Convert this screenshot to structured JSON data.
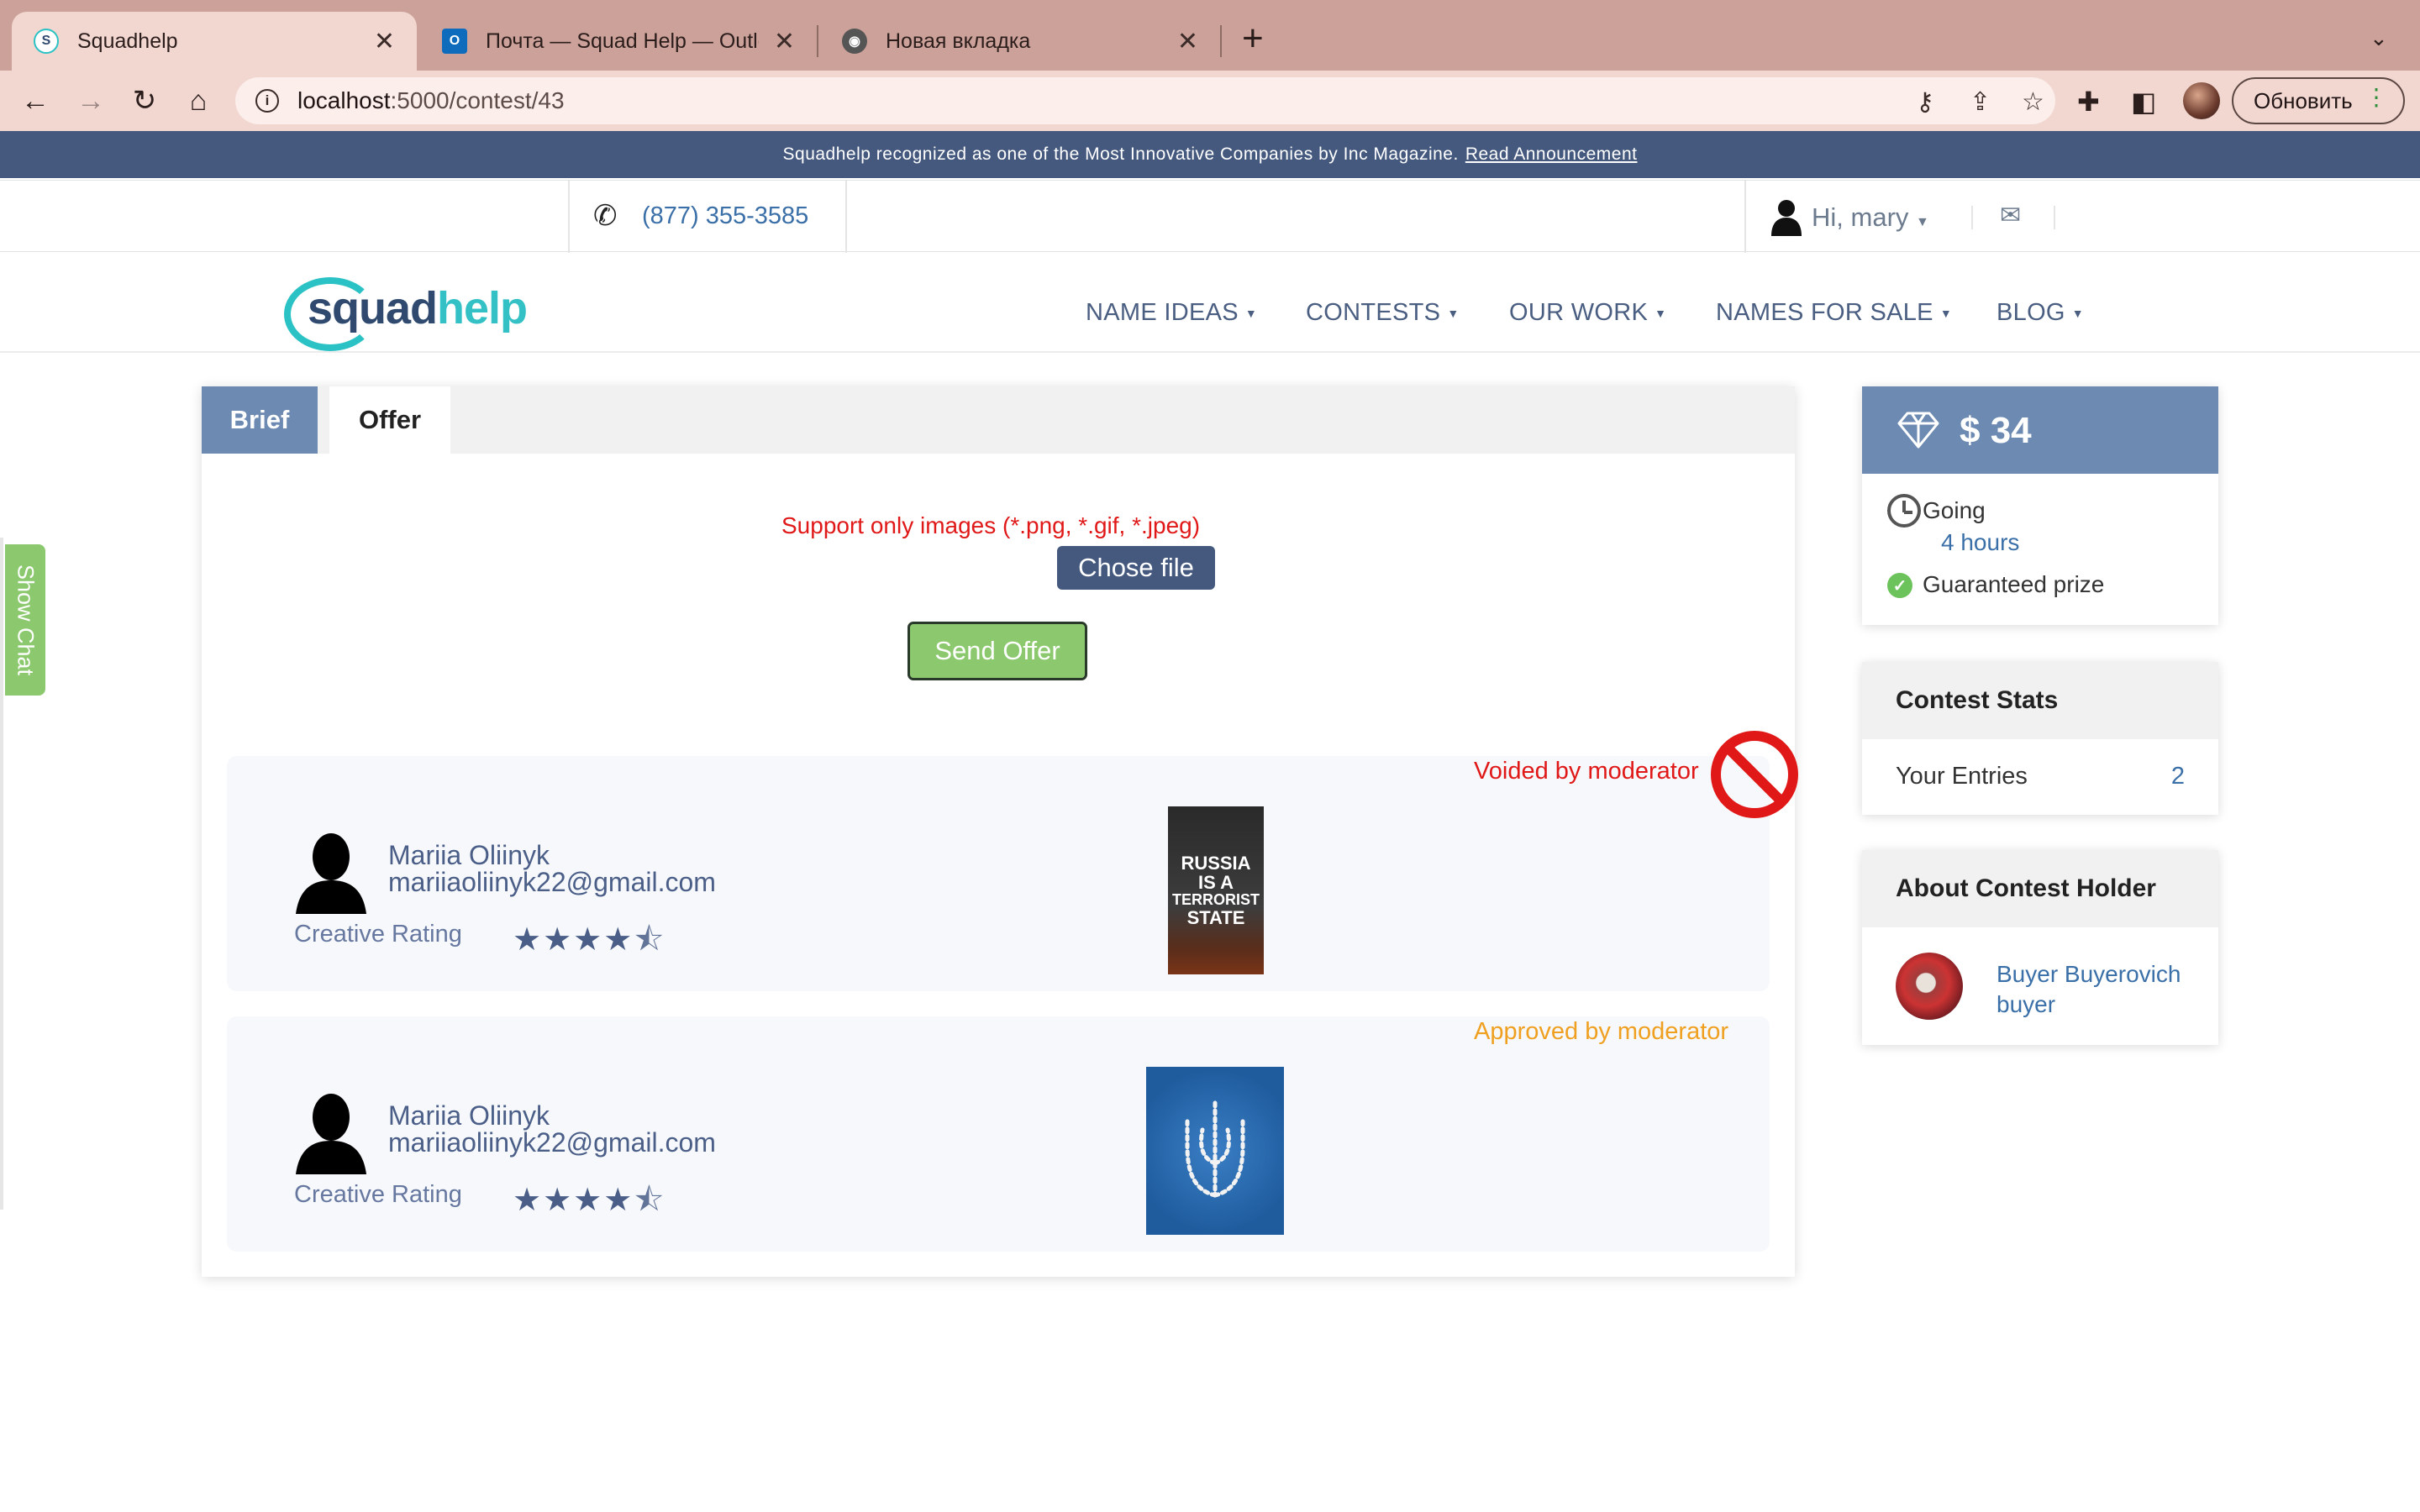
{
  "browser": {
    "tabs": [
      {
        "title": "Squadhelp",
        "active": true,
        "icon": "squadhelp-favicon"
      },
      {
        "title": "Почта — Squad Help — Outlook",
        "active": false,
        "icon": "outlook-icon"
      },
      {
        "title": "Новая вкладка",
        "active": false,
        "icon": "chrome-icon"
      }
    ],
    "url_host": "localhost",
    "url_path": ":5000/contest/43",
    "update_label": "Обновить"
  },
  "announcement": {
    "text": "Squadhelp recognized as one of the Most Innovative Companies by Inc Magazine.",
    "link": "Read Announcement"
  },
  "header": {
    "phone": "(877) 355-3585",
    "greeting": "Hi, mary"
  },
  "logo": {
    "part1": "squad",
    "part2": "help"
  },
  "nav": [
    "NAME IDEAS",
    "CONTESTS",
    "OUR WORK",
    "NAMES FOR SALE",
    "BLOG"
  ],
  "tabs": {
    "brief": "Brief",
    "offer": "Offer"
  },
  "offer_form": {
    "support_text": "Support only images (*.png, *.gif, *.jpeg)",
    "file_button": "Chose file",
    "send_button": "Send Offer"
  },
  "entries": [
    {
      "name": "Mariia Oliinyk",
      "email": "mariiaoliinyk22@gmail.com",
      "rating_label": "Creative Rating",
      "rating": 4.5,
      "status": "Voided by moderator",
      "image_lines": [
        "RUSSIA",
        "IS A",
        "TERRORIST",
        "STATE"
      ]
    },
    {
      "name": "Mariia Oliinyk",
      "email": "mariiaoliinyk22@gmail.com",
      "rating_label": "Creative Rating",
      "rating": 4.5,
      "status": "Approved by moderator"
    }
  ],
  "prize": {
    "amount": "$ 34",
    "going": "Going",
    "time_left": "4 hours",
    "guaranteed": "Guaranteed prize"
  },
  "stats": {
    "title": "Contest Stats",
    "entries_label": "Your Entries",
    "entries_value": "2"
  },
  "holder": {
    "title": "About Contest Holder",
    "name": "Buyer Buyerovich",
    "role": "buyer"
  },
  "chat": {
    "label": "Show Chat"
  },
  "colors": {
    "brand_blue": "#45597f",
    "tab_blue": "#6c8ab2",
    "green": "#8cc96e",
    "void_red": "#e01818",
    "approved_orange": "#f0a020"
  }
}
